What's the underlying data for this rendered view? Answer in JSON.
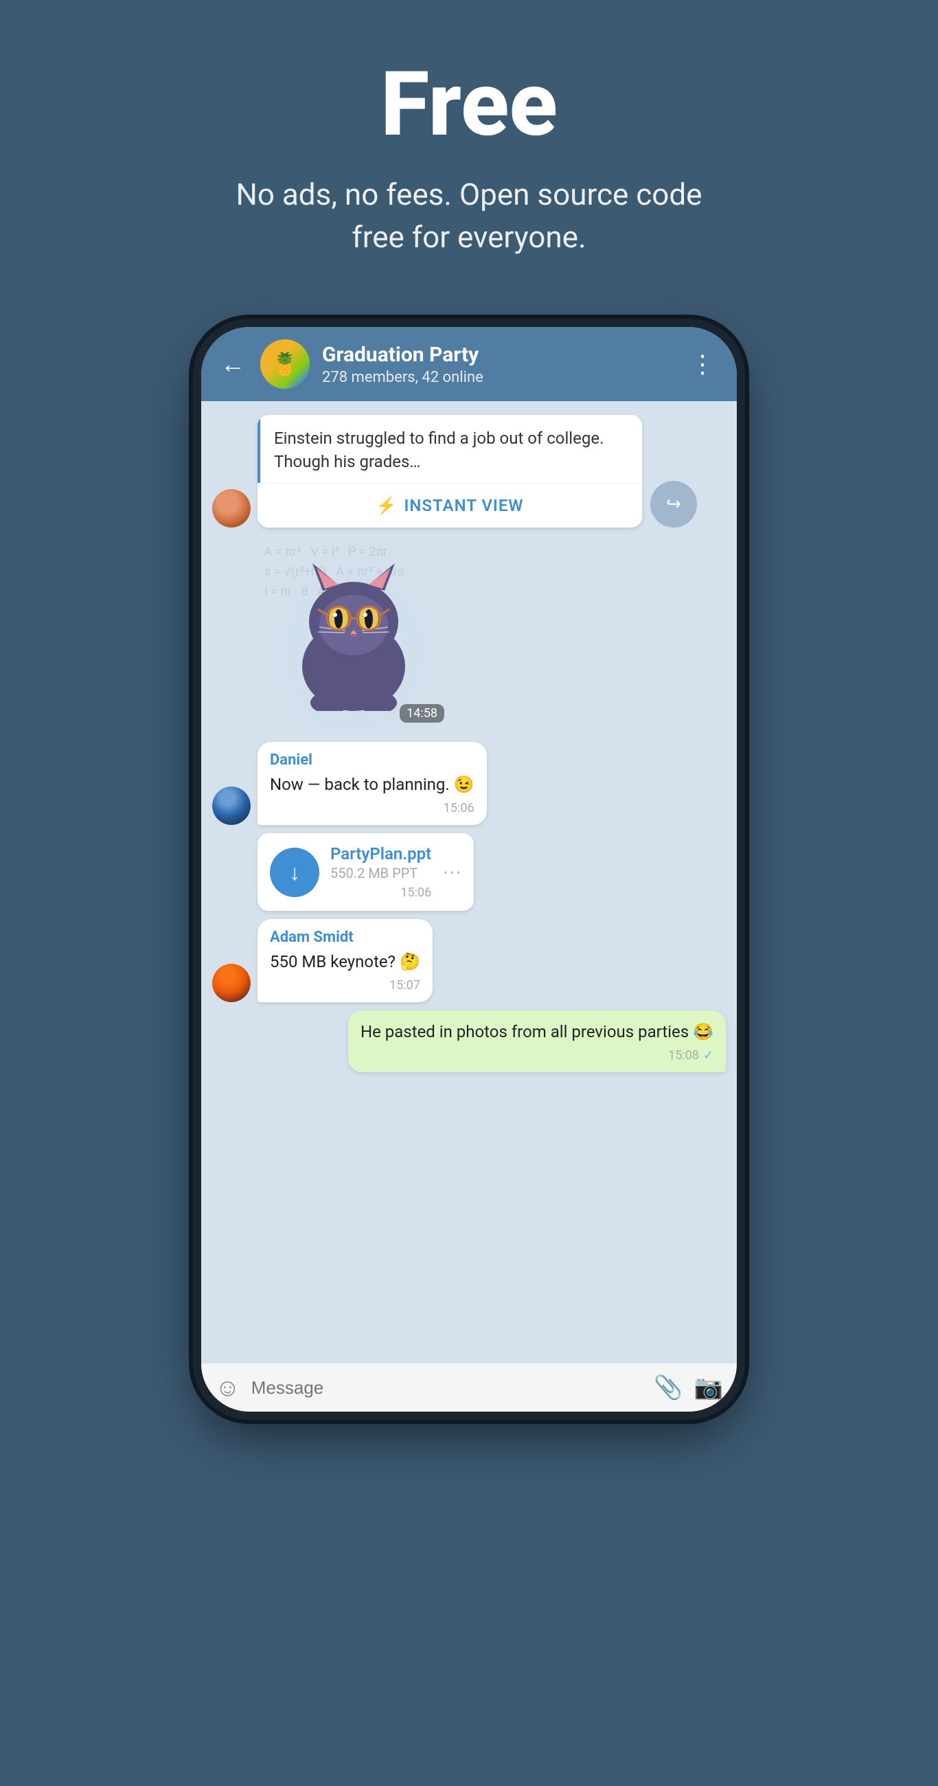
{
  "header": {
    "title": "Free",
    "subtitle": "No ads, no fees. Open source code free for everyone."
  },
  "chat": {
    "group_name": "Graduation Party",
    "group_status": "278 members, 42 online",
    "back_label": "←",
    "more_label": "⋮"
  },
  "messages": [
    {
      "id": "article",
      "type": "article",
      "text": "Einstein struggled to find a job out of college. Though his grades…",
      "instant_view_label": "INSTANT VIEW"
    },
    {
      "id": "sticker",
      "type": "sticker",
      "time": "14:58"
    },
    {
      "id": "daniel-msg",
      "type": "text",
      "sender": "Daniel",
      "text": "Now — back to planning. 😉",
      "time": "15:06"
    },
    {
      "id": "file-msg",
      "type": "file",
      "file_name": "PartyPlan.ppt",
      "file_size": "550.2 MB PPT",
      "time": "15:06"
    },
    {
      "id": "adam-msg",
      "type": "text",
      "sender": "Adam Smidt",
      "text": "550 MB keynote? 🤔",
      "time": "15:07"
    },
    {
      "id": "outgoing-msg",
      "type": "outgoing",
      "text": "He pasted in photos from all previous parties 😂",
      "time": "15:08"
    }
  ],
  "input_bar": {
    "placeholder": "Message"
  },
  "icons": {
    "back": "←",
    "more": "⋮",
    "lightning": "⚡",
    "share": "↪",
    "download": "↓",
    "emoji": "☺",
    "attach": "📎",
    "camera": "📷"
  }
}
